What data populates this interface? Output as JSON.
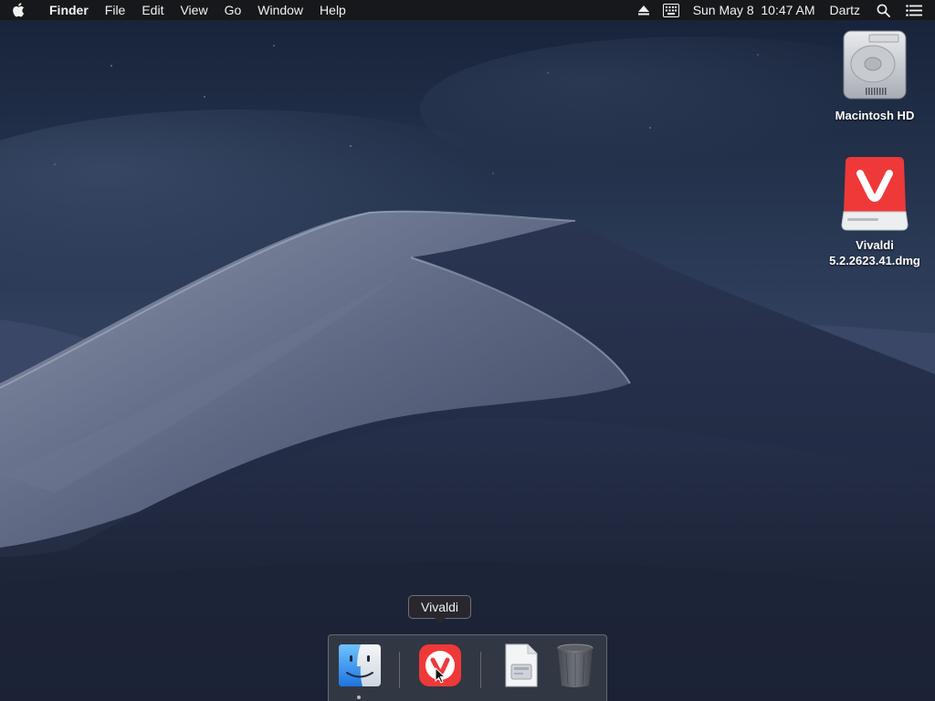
{
  "menubar": {
    "app_name": "Finder",
    "menus": [
      "File",
      "Edit",
      "View",
      "Go",
      "Window",
      "Help"
    ],
    "status": {
      "datetime": "Sun May 8  10:47 AM",
      "user": "Dartz"
    },
    "icons": [
      "apple-icon",
      "eject-icon",
      "input-menu-icon",
      "spotlight-search-icon",
      "notification-center-icon"
    ]
  },
  "desktop": {
    "icons": [
      {
        "label": "Macintosh HD",
        "icon": "hard-drive-icon"
      },
      {
        "label": "Vivaldi\n5.2.2623.41.dmg",
        "label_line1": "Vivaldi",
        "label_line2": "5.2.2623.41.dmg",
        "icon": "dmg-disk-image-icon"
      }
    ]
  },
  "dock": {
    "tooltip": "Vivaldi",
    "items": [
      {
        "name": "Finder",
        "icon": "finder-icon",
        "running": true
      },
      {
        "name": "Vivaldi",
        "icon": "vivaldi-icon",
        "running": false
      },
      {
        "name": "Downloads",
        "icon": "document-stack-icon",
        "running": false
      },
      {
        "name": "Trash",
        "icon": "trash-icon",
        "running": false
      }
    ]
  },
  "colors": {
    "vivaldi_red": "#ef3939",
    "menubar_bg": "#18181a",
    "sky_top": "#152033",
    "sky_bottom": "#3a4a66"
  }
}
